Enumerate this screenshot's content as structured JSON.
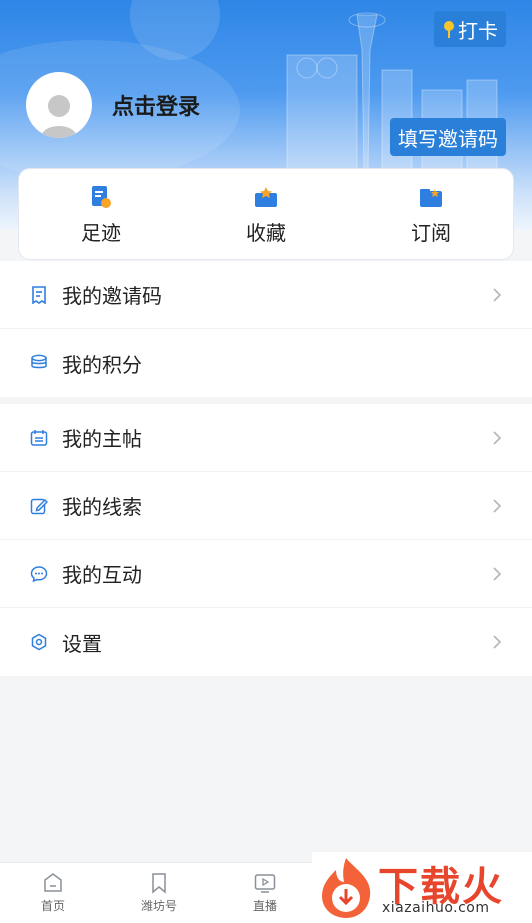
{
  "header": {
    "clockin_label": "打卡",
    "login_label": "点击登录",
    "invite_button_label": "填写邀请码"
  },
  "quick_actions": [
    {
      "label": "足迹",
      "icon": "footprint-icon"
    },
    {
      "label": "收藏",
      "icon": "favorites-icon"
    },
    {
      "label": "订阅",
      "icon": "subscribe-icon"
    }
  ],
  "menu_group_1": [
    {
      "label": "我的邀请码",
      "icon": "invite-code-icon",
      "chevron": true
    },
    {
      "label": "我的积分",
      "icon": "points-icon",
      "chevron": false
    }
  ],
  "menu_group_2": [
    {
      "label": "我的主帖",
      "icon": "posts-icon",
      "chevron": true
    },
    {
      "label": "我的线索",
      "icon": "edit-clue-icon",
      "chevron": true
    },
    {
      "label": "我的互动",
      "icon": "chat-icon",
      "chevron": true
    },
    {
      "label": "设置",
      "icon": "settings-icon",
      "chevron": true
    }
  ],
  "tabbar": [
    {
      "label": "首页",
      "icon": "home-icon"
    },
    {
      "label": "潍坊号",
      "icon": "bookmark-icon"
    },
    {
      "label": "直播",
      "icon": "live-tv-icon"
    }
  ],
  "watermark": {
    "title": "下载火",
    "url": "xiazaihuo.com"
  },
  "colors": {
    "accent": "#2a7fd9",
    "icon_blue": "#2f7fe0",
    "icon_orange": "#f7a428",
    "watermark_red": "#e8462c"
  }
}
